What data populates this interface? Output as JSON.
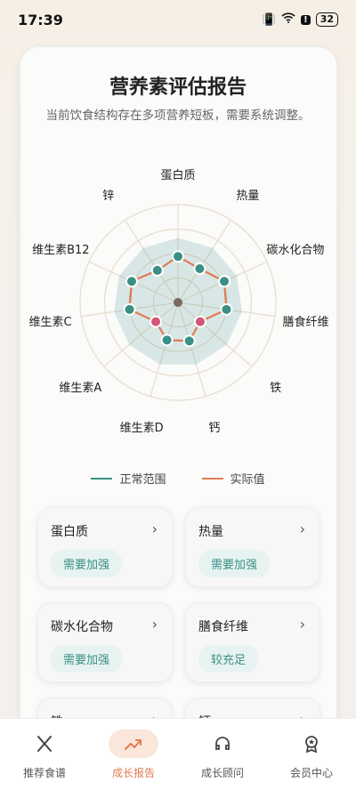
{
  "status_bar": {
    "time": "17:39",
    "battery": "32"
  },
  "report": {
    "title": "营养素评估报告",
    "subtitle": "当前饮食结构存在多项营养短板，需要系统调整。"
  },
  "chart_data": {
    "type": "radar",
    "categories": [
      "蛋白质",
      "热量",
      "碳水化合物",
      "膳食纤维",
      "铁",
      "钙",
      "维生素D",
      "维生素A",
      "维生素C",
      "维生素B12",
      "锌"
    ],
    "series": [
      {
        "name": "正常范围",
        "values": [
          0.6,
          0.6,
          0.6,
          0.6,
          0.6,
          0.6,
          0.6,
          0.6,
          0.6,
          0.6,
          0.6
        ],
        "color": "#3b8f86"
      },
      {
        "name": "实际值",
        "values": [
          0.47,
          0.41,
          0.52,
          0.5,
          0.3,
          0.41,
          0.4,
          0.3,
          0.5,
          0.52,
          0.39
        ],
        "color": "#e07b54",
        "low_points": [
          4,
          7
        ]
      }
    ],
    "legend": [
      {
        "label": "正常范围",
        "color": "#3b8f86"
      },
      {
        "label": "实际值",
        "color": "#e07b54"
      }
    ],
    "legend_position": "bottom"
  },
  "nutrients": [
    {
      "name": "蛋白质",
      "status": "需要加强"
    },
    {
      "name": "热量",
      "status": "需要加强"
    },
    {
      "name": "碳水化合物",
      "status": "需要加强"
    },
    {
      "name": "膳食纤维",
      "status": "较充足"
    },
    {
      "name": "铁",
      "status": ""
    },
    {
      "name": "钙",
      "status": ""
    }
  ],
  "nav": {
    "tabs": [
      {
        "label": "推荐食谱",
        "icon": "fork-knife-icon"
      },
      {
        "label": "成长报告",
        "icon": "trend-icon",
        "active": true
      },
      {
        "label": "成长顾问",
        "icon": "headset-icon"
      },
      {
        "label": "会员中心",
        "icon": "medal-icon"
      }
    ]
  }
}
